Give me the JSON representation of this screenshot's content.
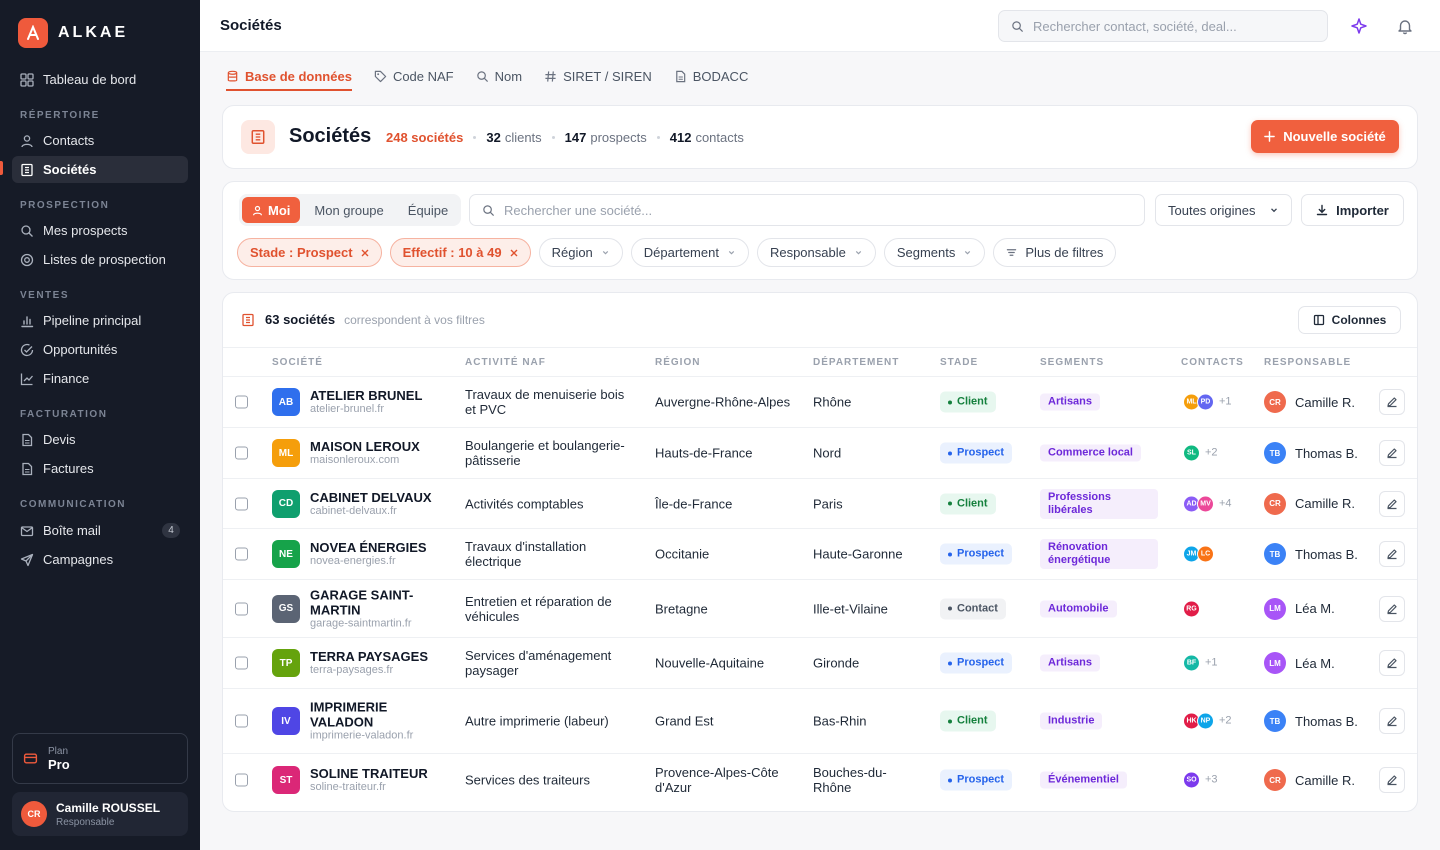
{
  "app": {
    "brand": "ALKAE",
    "logo_letter": "A",
    "accent": "#ef5a3c"
  },
  "sidebar": {
    "items": [
      {
        "label": "Tableau de bord",
        "icon": "dashboard-icon"
      },
      {
        "label": "Contacts",
        "icon": "user-icon"
      },
      {
        "label": "Sociétés",
        "icon": "building-icon",
        "active": true
      },
      {
        "label": "Mes prospects",
        "icon": "search-icon"
      },
      {
        "label": "Listes de prospection",
        "icon": "target-icon"
      },
      {
        "label": "Pipeline principal",
        "icon": "bar-chart-icon"
      },
      {
        "label": "Opportunités",
        "icon": "check-circle-icon"
      },
      {
        "label": "Finance",
        "icon": "trend-icon"
      },
      {
        "label": "Devis",
        "icon": "document-icon"
      },
      {
        "label": "Factures",
        "icon": "document-icon"
      },
      {
        "label": "Boîte mail",
        "icon": "mail-icon",
        "badge": "4"
      },
      {
        "label": "Campagnes",
        "icon": "send-icon"
      }
    ],
    "sections": [
      "RÉPERTOIRE",
      "PROSPECTION",
      "VENTES",
      "FACTURATION",
      "COMMUNICATION"
    ],
    "plan": {
      "label": "Plan",
      "value": "Pro"
    },
    "user": {
      "initials": "CR",
      "name": "Camille ROUSSEL",
      "role": "Responsable"
    }
  },
  "topbar": {
    "title": "Sociétés",
    "search_placeholder": "Rechercher contact, société, deal..."
  },
  "tabs": [
    {
      "label": "Base de données",
      "icon": "database-icon",
      "active": true
    },
    {
      "label": "Code NAF",
      "icon": "tag-icon"
    },
    {
      "label": "Nom",
      "icon": "search-icon"
    },
    {
      "label": "SIRET / SIREN",
      "icon": "hash-icon"
    },
    {
      "label": "BODACC",
      "icon": "file-icon"
    }
  ],
  "header": {
    "title": "Sociétés",
    "companies": "248 sociétés",
    "clients_num": "32",
    "clients_label": "clients",
    "prospects_num": "147",
    "prospects_label": "prospects",
    "contacts_num": "412",
    "contacts_label": "contacts",
    "new_button": "Nouvelle société"
  },
  "filters": {
    "scope": [
      "Moi",
      "Mon groupe",
      "Équipe"
    ],
    "search_placeholder": "Rechercher une société...",
    "origin": "Toutes origines",
    "import": "Importer",
    "active_chips": [
      "Stade : Prospect",
      "Effectif : 10 à 49"
    ],
    "chips": [
      "Région",
      "Département",
      "Responsable",
      "Segments",
      "Plus de filtres"
    ]
  },
  "table": {
    "count": "63 sociétés",
    "count_sub": "correspondent à vos filtres",
    "columns_button": "Colonnes",
    "headers": [
      "SOCIÉTÉ",
      "ACTIVITÉ NAF",
      "RÉGION",
      "DÉPARTEMENT",
      "STADE",
      "SEGMENTS",
      "CONTACTS",
      "RESPONSABLE"
    ],
    "rows": [
      {
        "logo": "AB",
        "logo_color": "#2f6fed",
        "name": "ATELIER BRUNEL",
        "domain": "atelier-brunel.fr",
        "naf": "Travaux de menuiserie bois et PVC",
        "region": "Auvergne-Rhône-Alpes",
        "dept": "Rhône",
        "stage": "Client",
        "segment": "Artisans",
        "contacts": [
          {
            "i": "ML",
            "c": "#f59e0b"
          },
          {
            "i": "PD",
            "c": "#6366f1"
          }
        ],
        "more": "+1",
        "resp": {
          "i": "CR",
          "name": "Camille R.",
          "c": "#ef6a4d"
        }
      },
      {
        "logo": "ML",
        "logo_color": "#f59e0b",
        "name": "MAISON LEROUX",
        "domain": "maisonleroux.com",
        "naf": "Boulangerie et boulangerie-pâtisserie",
        "region": "Hauts-de-France",
        "dept": "Nord",
        "stage": "Prospect",
        "segment": "Commerce local",
        "contacts": [
          {
            "i": "SL",
            "c": "#10b981"
          }
        ],
        "more": "+2",
        "resp": {
          "i": "TB",
          "name": "Thomas B.",
          "c": "#3b82f6"
        }
      },
      {
        "logo": "CD",
        "logo_color": "#0f9f6e",
        "name": "CABINET DELVAUX",
        "domain": "cabinet-delvaux.fr",
        "naf": "Activités comptables",
        "region": "Île-de-France",
        "dept": "Paris",
        "stage": "Client",
        "segment": "Professions libérales",
        "contacts": [
          {
            "i": "AD",
            "c": "#8b5cf6"
          },
          {
            "i": "MV",
            "c": "#ec4899"
          }
        ],
        "more": "+4",
        "resp": {
          "i": "CR",
          "name": "Camille R.",
          "c": "#ef6a4d"
        }
      },
      {
        "logo": "NE",
        "logo_color": "#16a34a",
        "name": "NOVEA ÉNERGIES",
        "domain": "novea-energies.fr",
        "naf": "Travaux d'installation électrique",
        "region": "Occitanie",
        "dept": "Haute-Garonne",
        "stage": "Prospect",
        "segment": "Rénovation énergétique",
        "contacts": [
          {
            "i": "JM",
            "c": "#0ea5e9"
          },
          {
            "i": "LC",
            "c": "#f97316"
          }
        ],
        "more": "",
        "resp": {
          "i": "TB",
          "name": "Thomas B.",
          "c": "#3b82f6"
        }
      },
      {
        "logo": "GS",
        "logo_color": "#5b6474",
        "name": "GARAGE SAINT-MARTIN",
        "domain": "garage-saintmartin.fr",
        "naf": "Entretien et réparation de véhicules",
        "region": "Bretagne",
        "dept": "Ille-et-Vilaine",
        "stage": "Contact",
        "segment": "Automobile",
        "contacts": [
          {
            "i": "RG",
            "c": "#e11d48"
          }
        ],
        "more": "",
        "resp": {
          "i": "LM",
          "name": "Léa M.",
          "c": "#a855f7"
        }
      },
      {
        "logo": "TP",
        "logo_color": "#65a30d",
        "name": "TERRA PAYSAGES",
        "domain": "terra-paysages.fr",
        "naf": "Services d'aménagement paysager",
        "region": "Nouvelle-Aquitaine",
        "dept": "Gironde",
        "stage": "Prospect",
        "segment": "Artisans",
        "contacts": [
          {
            "i": "BF",
            "c": "#14b8a6"
          }
        ],
        "more": "+1",
        "resp": {
          "i": "LM",
          "name": "Léa M.",
          "c": "#a855f7"
        }
      },
      {
        "logo": "IV",
        "logo_color": "#4f46e5",
        "name": "IMPRIMERIE VALADON",
        "domain": "imprimerie-valadon.fr",
        "naf": "Autre imprimerie (labeur)",
        "region": "Grand Est",
        "dept": "Bas-Rhin",
        "stage": "Client",
        "segment": "Industrie",
        "contacts": [
          {
            "i": "HK",
            "c": "#e11d48"
          },
          {
            "i": "NP",
            "c": "#0ea5e9"
          }
        ],
        "more": "+2",
        "resp": {
          "i": "TB",
          "name": "Thomas B.",
          "c": "#3b82f6"
        }
      },
      {
        "logo": "ST",
        "logo_color": "#db2777",
        "name": "SOLINE TRAITEUR",
        "domain": "soline-traiteur.fr",
        "naf": "Services des traiteurs",
        "region": "Provence-Alpes-Côte d'Azur",
        "dept": "Bouches-du-Rhône",
        "stage": "Prospect",
        "segment": "Événementiel",
        "contacts": [
          {
            "i": "SO",
            "c": "#7c3aed"
          }
        ],
        "more": "+3",
        "resp": {
          "i": "CR",
          "name": "Camille R.",
          "c": "#ef6a4d"
        }
      }
    ]
  }
}
